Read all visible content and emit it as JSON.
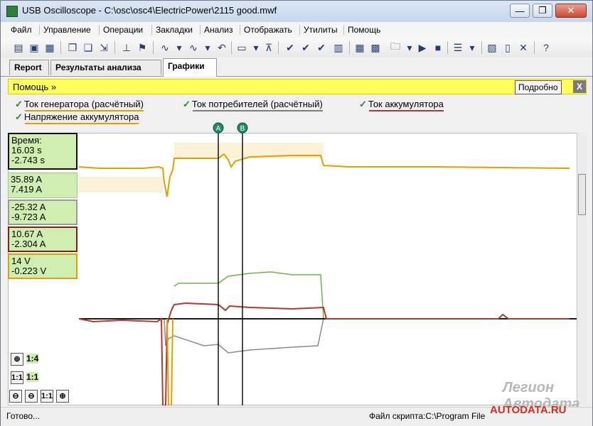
{
  "window": {
    "title": "USB Oscilloscope - C:\\osc\\osc4\\ElectricPower\\2115 good.mwf",
    "minimize": "—",
    "restore": "❐",
    "close": "✕"
  },
  "menu": [
    "Файл",
    "Управление",
    "Операции",
    "Закладки",
    "Анализ",
    "Отображать",
    "Утилиты",
    "Помощь"
  ],
  "tabs": [
    {
      "label": "Report",
      "active": false
    },
    {
      "label": "Результаты анализа",
      "active": false
    },
    {
      "label": "Графики",
      "active": true
    }
  ],
  "help_bar": {
    "text": "Помощь »",
    "details_button": "Подробно",
    "close_label": "X"
  },
  "legend": [
    {
      "label": "Ток генератора (расчётный)",
      "color": "#e1a000"
    },
    {
      "label": "Ток потребителей (расчётный)",
      "color": "#7f7f7f"
    },
    {
      "label": "Ток аккумулятора",
      "color": "#b23a2a"
    },
    {
      "label": "Напряжение аккумулятора",
      "color": "#e1a000"
    }
  ],
  "readouts": {
    "time": {
      "line1": "Время:",
      "line2": "16.03 s",
      "line3": "-2.743 s"
    },
    "channel1": {
      "line1": "35.89 A",
      "line2": "7.419 A"
    },
    "channel2": {
      "line1": "-25.32 A",
      "line2": "-9.723 A"
    },
    "channel3": {
      "line1": "10.67 A",
      "line2": "-2.304 A"
    },
    "channel4": {
      "line1": "14 V",
      "line2": "-0.223 V"
    }
  },
  "zoom": {
    "ratio_a": "1:4",
    "ratio_b": "1:1",
    "one_to_one": "1:1"
  },
  "markers": {
    "a_label": "A",
    "b_label": "B"
  },
  "colors": {
    "generator": "#e1a000",
    "consumers": "#6fb24d",
    "consumers_neg": "#8a8a8a",
    "battery_current": "#b23a2a",
    "voltage": "#e1a000",
    "marker": "#1f8a6e",
    "baseline": "#1a1a1a"
  },
  "status": {
    "left": "Готово...",
    "right": "Файл скрипта:C:\\Program File"
  },
  "watermark": {
    "top": "Легион Автодата",
    "bottom": "AUTODATA.RU"
  }
}
